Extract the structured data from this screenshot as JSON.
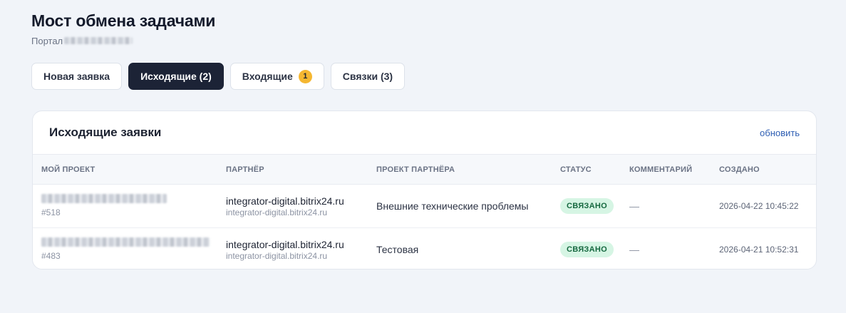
{
  "header": {
    "title": "Мост обмена задачами",
    "portal_label": "Портал"
  },
  "tabs": [
    {
      "label": "Новая заявка",
      "active": false
    },
    {
      "label": "Исходящие (2)",
      "active": true
    },
    {
      "label": "Входящие",
      "active": false,
      "badge": "1"
    },
    {
      "label": "Связки (3)",
      "active": false
    }
  ],
  "outgoing": {
    "title": "Исходящие заявки",
    "refresh_label": "обновить",
    "columns": [
      "Мой проект",
      "Партнёр",
      "Проект партнёра",
      "Статус",
      "Комментарий",
      "Создано"
    ],
    "rows": [
      {
        "project_id": "#518",
        "partner": "integrator-digital.bitrix24.ru",
        "partner_sub": "integrator-digital.bitrix24.ru",
        "partner_project": "Внешние технические проблемы",
        "status": "СВЯЗАНО",
        "comment": "—",
        "created": "2026-04-22 10:45:22"
      },
      {
        "project_id": "#483",
        "partner": "integrator-digital.bitrix24.ru",
        "partner_sub": "integrator-digital.bitrix24.ru",
        "partner_project": "Тестовая",
        "status": "СВЯЗАНО",
        "comment": "—",
        "created": "2026-04-21 10:52:31"
      }
    ]
  },
  "colors": {
    "background": "#f1f4f9",
    "active_tab": "#1c2336",
    "badge": "#f5b731",
    "status_bg": "#d6f5e4",
    "status_text": "#15683f",
    "link": "#2f5fb3"
  }
}
